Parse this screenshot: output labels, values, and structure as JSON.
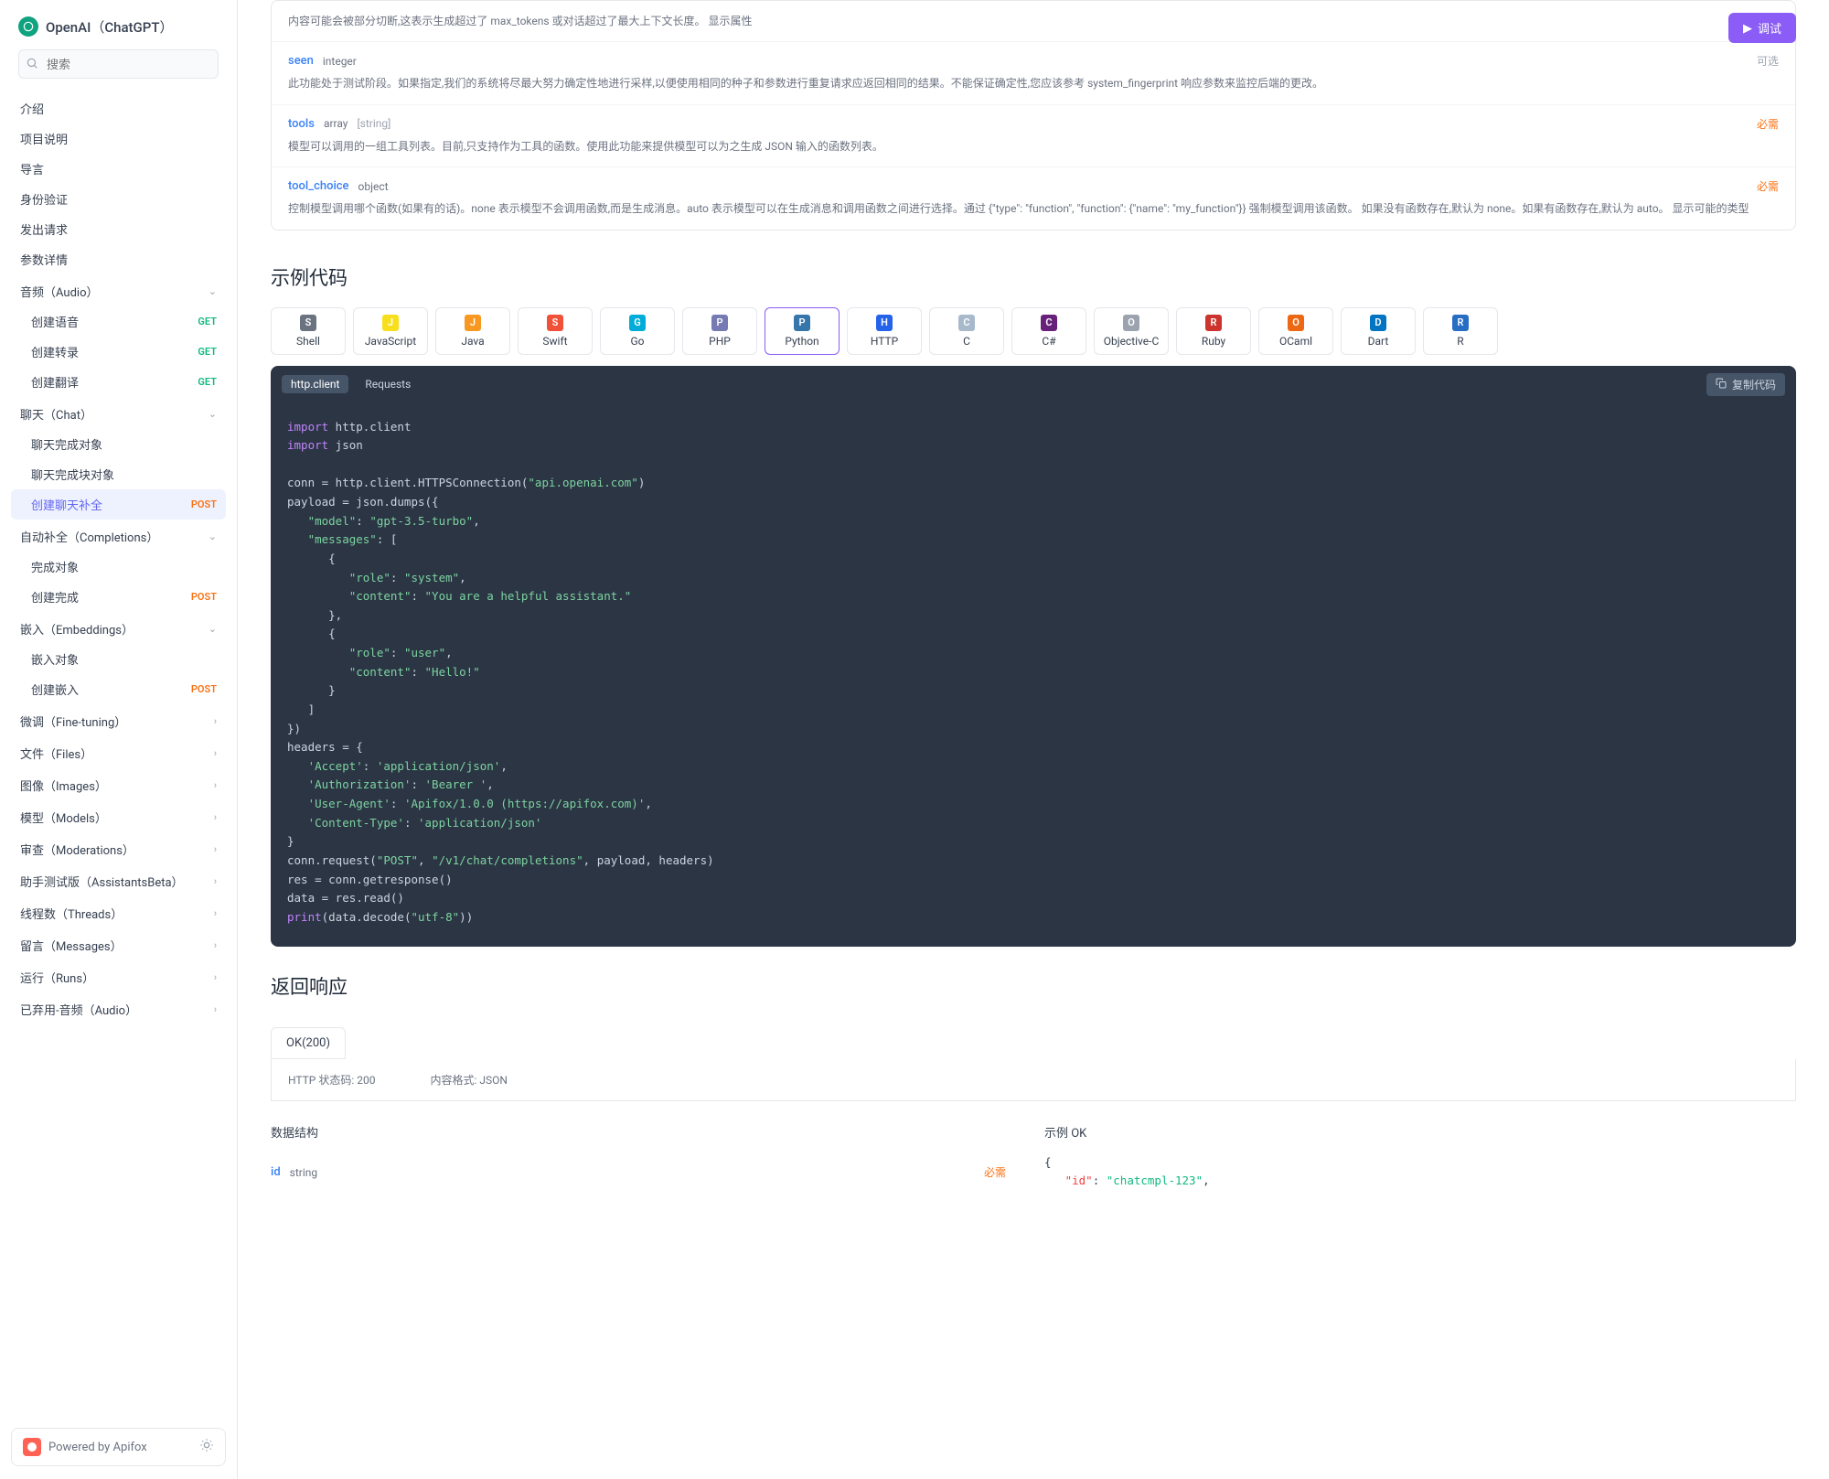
{
  "brand": "OpenAI（ChatGPT）",
  "search_placeholder": "搜索",
  "run_button": "调试",
  "nav_simple": [
    "介绍",
    "项目说明",
    "导言",
    "身份验证",
    "发出请求",
    "参数详情"
  ],
  "nav_sections": [
    {
      "label": "音频（Audio）",
      "open": true,
      "children": [
        {
          "label": "创建语音",
          "verb": "GET"
        },
        {
          "label": "创建转录",
          "verb": "GET"
        },
        {
          "label": "创建翻译",
          "verb": "GET"
        }
      ]
    },
    {
      "label": "聊天（Chat）",
      "open": true,
      "children": [
        {
          "label": "聊天完成对象"
        },
        {
          "label": "聊天完成块对象"
        },
        {
          "label": "创建聊天补全",
          "verb": "POST",
          "active": true
        }
      ]
    },
    {
      "label": "自动补全（Completions）",
      "open": true,
      "children": [
        {
          "label": "完成对象"
        },
        {
          "label": "创建完成",
          "verb": "POST"
        }
      ]
    },
    {
      "label": "嵌入（Embeddings）",
      "open": true,
      "children": [
        {
          "label": "嵌入对象"
        },
        {
          "label": "创建嵌入",
          "verb": "POST"
        }
      ]
    },
    {
      "label": "微调（Fine-tuning）"
    },
    {
      "label": "文件（Files）"
    },
    {
      "label": "图像（Images）"
    },
    {
      "label": "模型（Models）"
    },
    {
      "label": "审查（Moderations）"
    },
    {
      "label": "助手测试版（AssistantsBeta）"
    },
    {
      "label": "线程数（Threads）"
    },
    {
      "label": "留言（Messages）"
    },
    {
      "label": "运行（Runs）"
    },
    {
      "label": "已弃用-音频（Audio）"
    }
  ],
  "footer": "Powered by Apifox",
  "params": [
    {
      "desc": "内容可能会被部分切断,这表示生成超过了 max_tokens 或对话超过了最大上下文长度。 显示属性"
    },
    {
      "name": "seen",
      "type": "integer",
      "req": "可选",
      "desc": "此功能处于测试阶段。如果指定,我们的系统将尽最大努力确定性地进行采样,以便使用相同的种子和参数进行重复请求应返回相同的结果。不能保证确定性,您应该参考 system_fingerprint 响应参数来监控后端的更改。"
    },
    {
      "name": "tools",
      "type": "array",
      "subtype": "[string]",
      "req": "必需",
      "desc": "模型可以调用的一组工具列表。目前,只支持作为工具的函数。使用此功能来提供模型可以为之生成 JSON 输入的函数列表。"
    },
    {
      "name": "tool_choice",
      "type": "object",
      "req": "必需",
      "desc": "控制模型调用哪个函数(如果有的话)。none 表示模型不会调用函数,而是生成消息。auto 表示模型可以在生成消息和调用函数之间进行选择。通过 {\"type\": \"function\", \"function\": {\"name\": \"my_function\"}} 强制模型调用该函数。 如果没有函数存在,默认为 none。如果有函数存在,默认为 auto。 显示可能的类型"
    }
  ],
  "req_labels": {
    "required": "必需",
    "optional": "可选"
  },
  "section_code": "示例代码",
  "section_response": "返回响应",
  "langs": [
    "Shell",
    "JavaScript",
    "Java",
    "Swift",
    "Go",
    "PHP",
    "Python",
    "HTTP",
    "C",
    "C#",
    "Objective-C",
    "Ruby",
    "OCaml",
    "Dart",
    "R"
  ],
  "lang_colors": {
    "Shell": "#6b7280",
    "JavaScript": "#f7df1e",
    "Java": "#f89820",
    "Swift": "#f05138",
    "Go": "#00add8",
    "PHP": "#777bb3",
    "Python": "#3776ab",
    "HTTP": "#2563eb",
    "C": "#a8b9cc",
    "C#": "#68217a",
    "Objective-C": "#9ca3af",
    "Ruby": "#cc342d",
    "OCaml": "#ec6813",
    "Dart": "#0175c2",
    "R": "#276dc3"
  },
  "code_tabs": [
    "http.client",
    "Requests"
  ],
  "copy_label": "复制代码",
  "code_tokens": [
    [
      "k",
      "import"
    ],
    [
      "n",
      " http.client\n"
    ],
    [
      "k",
      "import"
    ],
    [
      "n",
      " json\n\n"
    ],
    [
      "n",
      "conn = http.client.HTTPSConnection("
    ],
    [
      "s",
      "\"api.openai.com\""
    ],
    [
      "n",
      ")\n"
    ],
    [
      "n",
      "payload = json.dumps({\n   "
    ],
    [
      "s",
      "\"model\""
    ],
    [
      "n",
      ": "
    ],
    [
      "s",
      "\"gpt-3.5-turbo\""
    ],
    [
      "n",
      ",\n   "
    ],
    [
      "s",
      "\"messages\""
    ],
    [
      "n",
      ": [\n      {\n         "
    ],
    [
      "s",
      "\"role\""
    ],
    [
      "n",
      ": "
    ],
    [
      "s",
      "\"system\""
    ],
    [
      "n",
      ",\n         "
    ],
    [
      "s",
      "\"content\""
    ],
    [
      "n",
      ": "
    ],
    [
      "s",
      "\"You are a helpful assistant.\""
    ],
    [
      "n",
      "\n      },\n      {\n         "
    ],
    [
      "s",
      "\"role\""
    ],
    [
      "n",
      ": "
    ],
    [
      "s",
      "\"user\""
    ],
    [
      "n",
      ",\n         "
    ],
    [
      "s",
      "\"content\""
    ],
    [
      "n",
      ": "
    ],
    [
      "s",
      "\"Hello!\""
    ],
    [
      "n",
      "\n      }\n   ]\n})\nheaders = {\n   "
    ],
    [
      "s",
      "'Accept'"
    ],
    [
      "n",
      ": "
    ],
    [
      "s",
      "'application/json'"
    ],
    [
      "n",
      ",\n   "
    ],
    [
      "s",
      "'Authorization'"
    ],
    [
      "n",
      ": "
    ],
    [
      "s",
      "'Bearer '"
    ],
    [
      "n",
      ",\n   "
    ],
    [
      "s",
      "'User-Agent'"
    ],
    [
      "n",
      ": "
    ],
    [
      "s",
      "'Apifox/1.0.0 (https://apifox.com)'"
    ],
    [
      "n",
      ",\n   "
    ],
    [
      "s",
      "'Content-Type'"
    ],
    [
      "n",
      ": "
    ],
    [
      "s",
      "'application/json'"
    ],
    [
      "n",
      "\n}\nconn.request("
    ],
    [
      "s",
      "\"POST\""
    ],
    [
      "n",
      ", "
    ],
    [
      "s",
      "\"/v1/chat/completions\""
    ],
    [
      "n",
      ", payload, headers)\nres = conn.getresponse()\ndata = res.read()\n"
    ],
    [
      "k",
      "print"
    ],
    [
      "n",
      "(data.decode("
    ],
    [
      "s",
      "\"utf-8\""
    ],
    [
      "n",
      "))"
    ]
  ],
  "response": {
    "tab": "OK(200)",
    "status_label": "HTTP 状态码:",
    "status_value": "200",
    "content_label": "内容格式:",
    "content_value": "JSON",
    "struct_title": "数据结构",
    "example_title": "示例  OK",
    "struct_items": [
      {
        "name": "id",
        "type": "string",
        "req": "必需"
      }
    ],
    "example_key": "\"id\"",
    "example_val": "\"chatcmpl-123\""
  }
}
